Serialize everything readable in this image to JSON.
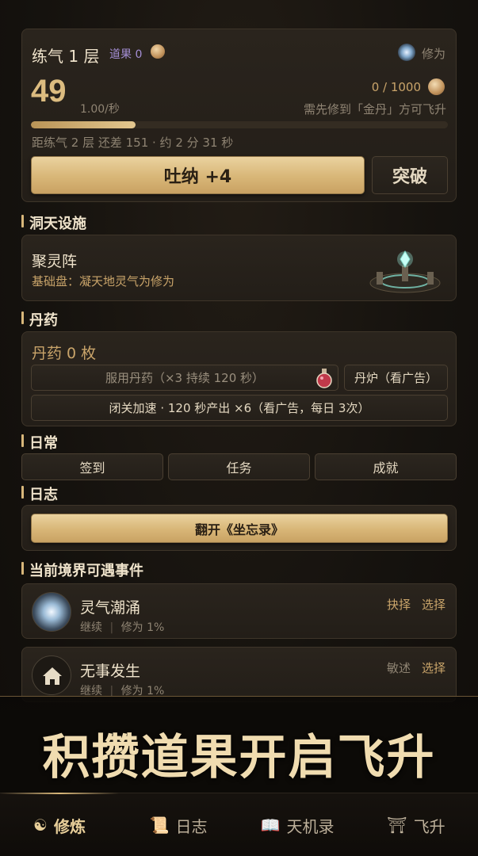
{
  "realm": {
    "name": "练气 1 层",
    "daoguo_label": "道果",
    "daoguo_value": "0",
    "cultivation_label": "修为",
    "cultivation_value": "49",
    "rate": "1.00/秒",
    "progress_text": "0 / 1000",
    "ascend_hint": "需先修到「金丹」方可飞升",
    "progress_fraction": 0.25,
    "next_level_text": "距练气 2 层 还差 151 · 约 2 分 31 秒",
    "breathe_button": "吐纳 +4",
    "breakthrough_button": "突破"
  },
  "facilities": {
    "title": "洞天设施",
    "item_name": "聚灵阵",
    "item_desc": "基础盘：凝天地灵气为修为"
  },
  "pills": {
    "title": "丹药",
    "count_text": "丹药 0 枚",
    "take_button": "服用丹药（×3 持续 120 秒）",
    "furnace_button": "丹炉（看广告）",
    "retreat_button": "闭关加速 · 120 秒产出 ×6（看广告，每日 3次）"
  },
  "daily": {
    "title": "日常",
    "buttons": [
      "签到",
      "任务",
      "成就"
    ]
  },
  "journal": {
    "title": "日志",
    "open_button": "翻开《坐忘录》"
  },
  "events": {
    "title": "当前境界可遇事件",
    "items": [
      {
        "name": "灵气潮涌",
        "meta_a": "继续",
        "meta_b": "修为 1%",
        "action_a": "抉择",
        "action_b": "选择",
        "icon": "spirit-orb-icon"
      },
      {
        "name": "无事发生",
        "meta_a": "继续",
        "meta_b": "修为 1%",
        "action_a": "敏述",
        "action_b": "选择",
        "icon": "house-icon"
      }
    ]
  },
  "banner": {
    "text": "积攒道果开启飞升"
  },
  "tabs": [
    {
      "label": "修炼",
      "icon": "☯",
      "active": true
    },
    {
      "label": "日志",
      "icon": "📜",
      "active": false
    },
    {
      "label": "天机录",
      "icon": "📖",
      "active": false
    },
    {
      "label": "飞升",
      "icon": "⛩",
      "active": false
    }
  ],
  "colors": {
    "accent_gold": "#d8b77a",
    "daoguo_purple": "#a58fd6",
    "background": "#15120e"
  }
}
